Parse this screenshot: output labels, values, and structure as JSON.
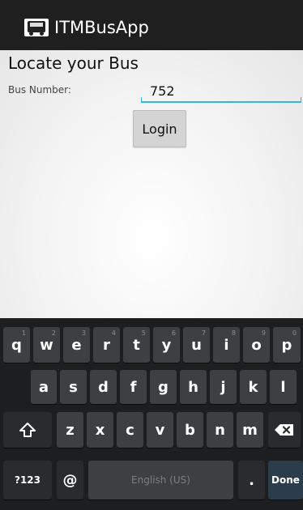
{
  "app": {
    "title": "ITMBusApp",
    "icon": "bus-icon"
  },
  "page": {
    "title": "Locate your Bus"
  },
  "form": {
    "bus_number_label": "Bus Number:",
    "bus_number_value": "752",
    "login_label": "Login"
  },
  "keyboard": {
    "row1": [
      {
        "key": "q",
        "hint": "1"
      },
      {
        "key": "w",
        "hint": "2"
      },
      {
        "key": "e",
        "hint": "3"
      },
      {
        "key": "r",
        "hint": "4"
      },
      {
        "key": "t",
        "hint": "5"
      },
      {
        "key": "y",
        "hint": "6"
      },
      {
        "key": "u",
        "hint": "7"
      },
      {
        "key": "i",
        "hint": "8"
      },
      {
        "key": "o",
        "hint": "9"
      },
      {
        "key": "p",
        "hint": "0"
      }
    ],
    "row2": [
      "a",
      "s",
      "d",
      "f",
      "g",
      "h",
      "j",
      "k",
      "l"
    ],
    "row3": [
      "z",
      "x",
      "c",
      "v",
      "b",
      "n",
      "m"
    ],
    "symbols_label": "?123",
    "at_label": "@",
    "space_label": "English (US)",
    "period_label": ".",
    "done_label": "Done",
    "shift_icon": "shift-icon",
    "backspace_icon": "backspace-icon"
  },
  "colors": {
    "action_bar": "#1f1f1f",
    "accent": "#33b5e5",
    "keyboard_bg": "#1d1e20",
    "key": "#3d3f43"
  }
}
